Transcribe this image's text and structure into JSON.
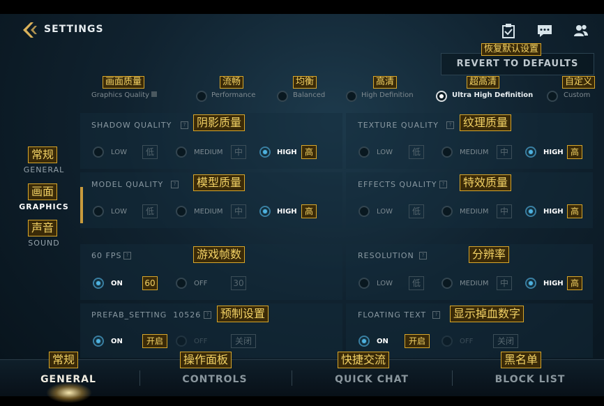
{
  "header": {
    "title": "SETTINGS",
    "icons": [
      "back-arrow-icon",
      "clipboard-check-icon",
      "chat-icon",
      "friends-icon"
    ],
    "revert_label": "REVERT TO DEFAULTS",
    "revert_tag": "恢复默认设置"
  },
  "preset": {
    "label": "Graphics Quality",
    "label_tag": "画面质量",
    "options": [
      {
        "label": "Performance",
        "tag": "流畅",
        "selected": false
      },
      {
        "label": "Balanced",
        "tag": "均衡",
        "selected": false
      },
      {
        "label": "High Definition",
        "tag": "高清",
        "selected": false
      },
      {
        "label": "Ultra High Definition",
        "tag": "超高清",
        "selected": true
      },
      {
        "label": "Custom",
        "tag": "自定义",
        "selected": false
      }
    ]
  },
  "sections": {
    "shadow": {
      "title": "SHADOW QUALITY",
      "tag": "阴影质量"
    },
    "texture": {
      "title": "TEXTURE QUALITY",
      "tag": "纹理质量"
    },
    "model": {
      "title": "MODEL QUALITY",
      "tag": "模型质量"
    },
    "effects": {
      "title": "EFFECTS QUALITY",
      "tag": "特效质量"
    },
    "fps": {
      "title": "60 FPS",
      "tag": "游戏帧数"
    },
    "resolution": {
      "title": "RESOLUTION",
      "tag": "分辨率"
    },
    "prefab": {
      "title": "PREFAB_SETTING",
      "extra": "10526",
      "tag": "预制设置"
    },
    "floating": {
      "title": "FLOATING TEXT",
      "tag": "显示掉血数字"
    }
  },
  "levels": {
    "low": "LOW",
    "low_tag": "低",
    "medium": "MEDIUM",
    "medium_tag": "中",
    "high": "HIGH",
    "high_tag": "高"
  },
  "toggles": {
    "fps_on": "ON",
    "fps_on_tag": "60",
    "fps_off": "OFF",
    "fps_off_tag": "30",
    "on": "ON",
    "on_tag": "开启",
    "off": "OFF",
    "off_tag": "关闭"
  },
  "nav": {
    "general": {
      "label": "GENERAL",
      "tag": "常规"
    },
    "graphics": {
      "label": "GRAPHICS",
      "tag": "画面"
    },
    "sound": {
      "label": "SOUND",
      "tag": "声音"
    }
  },
  "tabs": [
    {
      "label": "GENERAL",
      "tag": "常规",
      "selected": true
    },
    {
      "label": "CONTROLS",
      "tag": "操作面板",
      "selected": false
    },
    {
      "label": "QUICK CHAT",
      "tag": "快捷交流",
      "selected": false
    },
    {
      "label": "BLOCK LIST",
      "tag": "黑名单",
      "selected": false
    }
  ],
  "colors": {
    "accent_gold": "#c89b3c",
    "selected_blue": "#4fb2e0",
    "tag_gold": "#d9a72a"
  }
}
